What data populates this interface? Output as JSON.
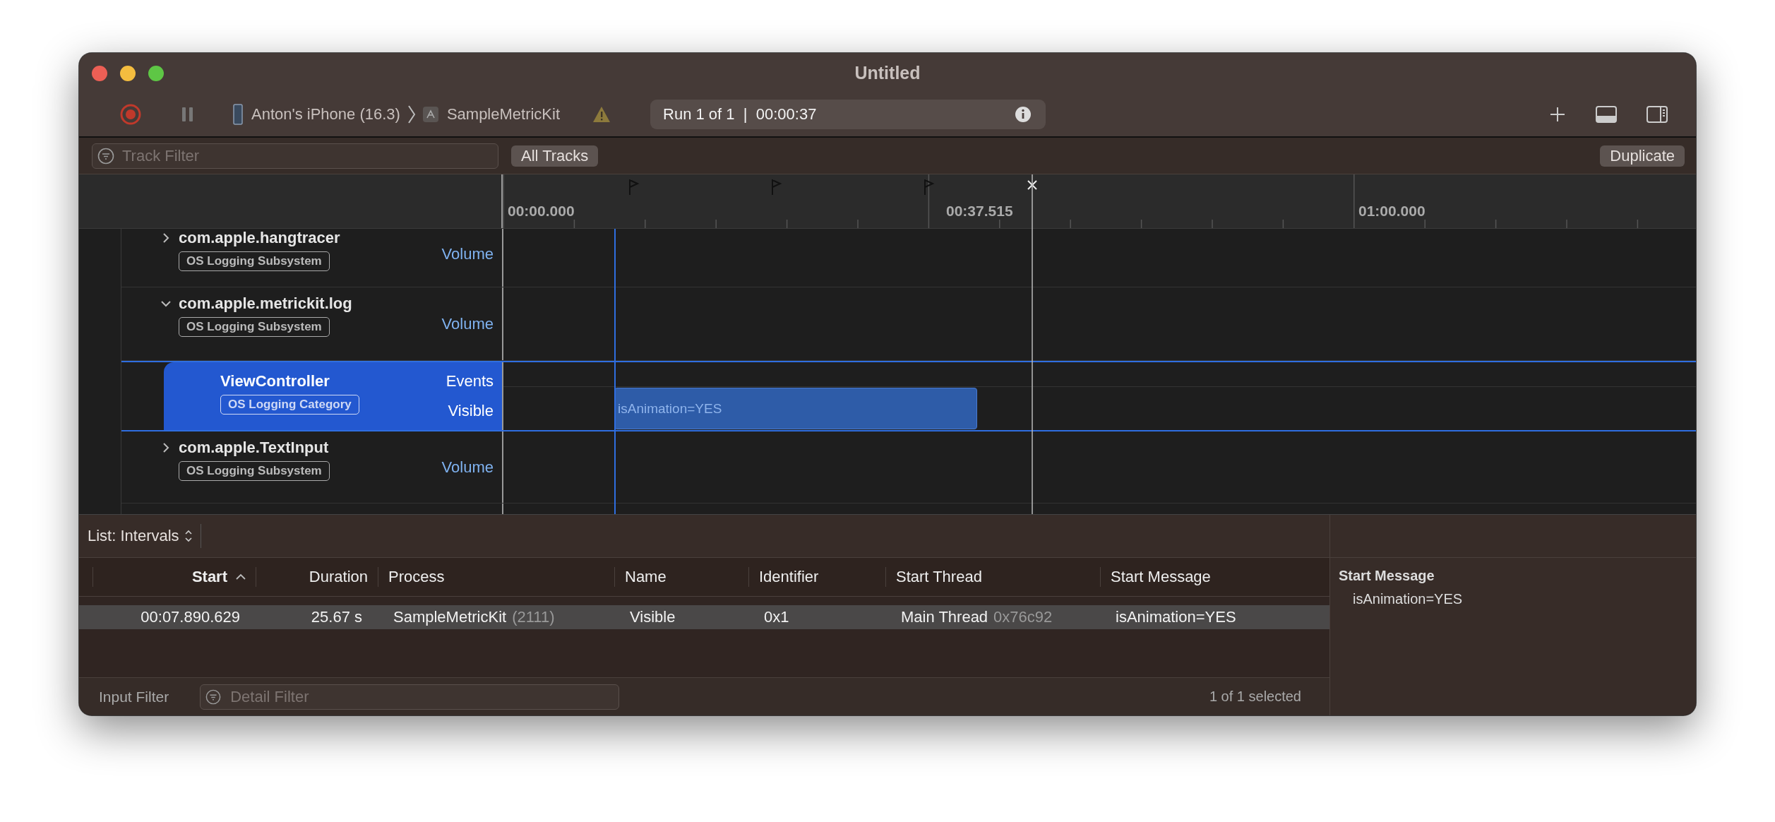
{
  "window": {
    "title": "Untitled"
  },
  "toolbar": {
    "device": "Anton's iPhone (16.3)",
    "target": "SampleMetricKit",
    "run_status": "Run 1 of 1  |  00:00:37"
  },
  "filter_bar": {
    "placeholder": "Track Filter",
    "scope_button": "All Tracks",
    "duplicate_button": "Duplicate"
  },
  "ruler": {
    "labels": [
      "00:00.000",
      "00:37.515",
      "01:00.000"
    ]
  },
  "tracks": [
    {
      "kind": "subsystem",
      "name": "com.apple.hangtracer",
      "tag": "OS Logging Subsystem",
      "expanded": false,
      "selected": false,
      "lanes": [
        "Volume"
      ]
    },
    {
      "kind": "subsystem",
      "name": "com.apple.metrickit.log",
      "tag": "OS Logging Subsystem",
      "expanded": true,
      "selected": false,
      "lanes": [
        "Volume"
      ]
    },
    {
      "kind": "category",
      "name": "ViewController",
      "tag": "OS Logging Category",
      "selected": true,
      "lanes": [
        "Events",
        "Visible"
      ],
      "interval_label": "isAnimation=YES"
    },
    {
      "kind": "subsystem",
      "name": "com.apple.TextInput",
      "tag": "OS Logging Subsystem",
      "expanded": false,
      "selected": false,
      "lanes": [
        "Volume"
      ]
    }
  ],
  "list": {
    "mode": "List: Intervals",
    "columns": [
      {
        "label": "Start",
        "sorted": true
      },
      {
        "label": "Duration",
        "sorted": false
      },
      {
        "label": "Process",
        "sorted": false
      },
      {
        "label": "Name",
        "sorted": false
      },
      {
        "label": "Identifier",
        "sorted": false
      },
      {
        "label": "Start Thread",
        "sorted": false
      },
      {
        "label": "Start Message",
        "sorted": false
      }
    ],
    "rows": [
      {
        "selected": true,
        "cells": [
          {
            "text": "00:07.890.629"
          },
          {
            "text": "25.67 s"
          },
          {
            "text": "SampleMetricKit",
            "detail": "(2111)"
          },
          {
            "text": "Visible"
          },
          {
            "text": "0x1"
          },
          {
            "text": "Main Thread",
            "detail": "0x76c92"
          },
          {
            "text": "isAnimation=YES"
          }
        ]
      }
    ],
    "input_filter_label": "Input Filter",
    "detail_filter_placeholder": "Detail Filter",
    "selection_count": "1 of 1 selected"
  },
  "detail_panel": {
    "heading": "Start Message",
    "value": "isAnimation=YES"
  }
}
